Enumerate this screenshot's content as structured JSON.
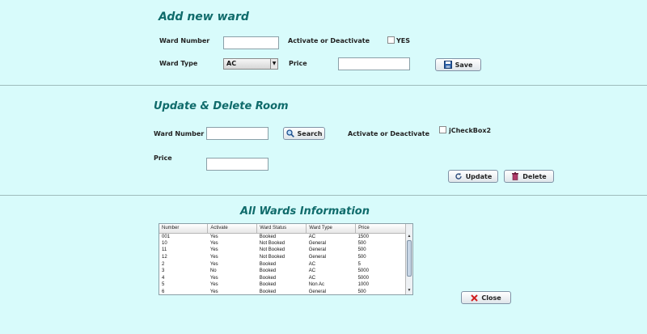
{
  "add_section": {
    "title": "Add new ward",
    "ward_number_label": "Ward Number",
    "ward_number_value": "",
    "activate_label": "Activate or Deactivate",
    "yes_label": "YES",
    "ward_type_label": "Ward Type",
    "ward_type_selected": "AC",
    "price_label": "Price",
    "price_value": "",
    "save_label": "Save"
  },
  "update_section": {
    "title": "Update & Delete Room",
    "ward_number_label": "Ward Number",
    "ward_number_value": "",
    "search_label": "Search",
    "activate_label": "Activate or Deactivate",
    "checkbox_label": "jCheckBox2",
    "price_label": "Price",
    "price_value": "",
    "update_label": "Update",
    "delete_label": "Delete"
  },
  "info_section": {
    "title": "All Wards Information",
    "columns": [
      "Number",
      "Activate",
      "Ward Status",
      "Ward Type",
      "Price"
    ],
    "rows": [
      [
        "001",
        "Yes",
        "Booked",
        "AC",
        "1500"
      ],
      [
        "10",
        "Yes",
        "Not Booked",
        "General",
        "500"
      ],
      [
        "11",
        "Yes",
        "Not Booked",
        "General",
        "500"
      ],
      [
        "12",
        "Yes",
        "Not Booked",
        "General",
        "500"
      ],
      [
        "2",
        "Yes",
        "Booked",
        "AC",
        "5"
      ],
      [
        "3",
        "No",
        "Booked",
        "AC",
        "5000"
      ],
      [
        "4",
        "Yes",
        "Booked",
        "AC",
        "5000"
      ],
      [
        "5",
        "Yes",
        "Booked",
        "Non Ac",
        "1000"
      ],
      [
        "6",
        "Yes",
        "Booked",
        "General",
        "500"
      ]
    ],
    "close_label": "Close"
  },
  "icons": {
    "save": "floppy-disk-icon",
    "search": "magnifier-icon",
    "update": "refresh-icon",
    "delete": "trash-icon",
    "close": "red-x-icon"
  },
  "colors": {
    "background": "#d8fbfb",
    "title": "#0f6b6b"
  }
}
